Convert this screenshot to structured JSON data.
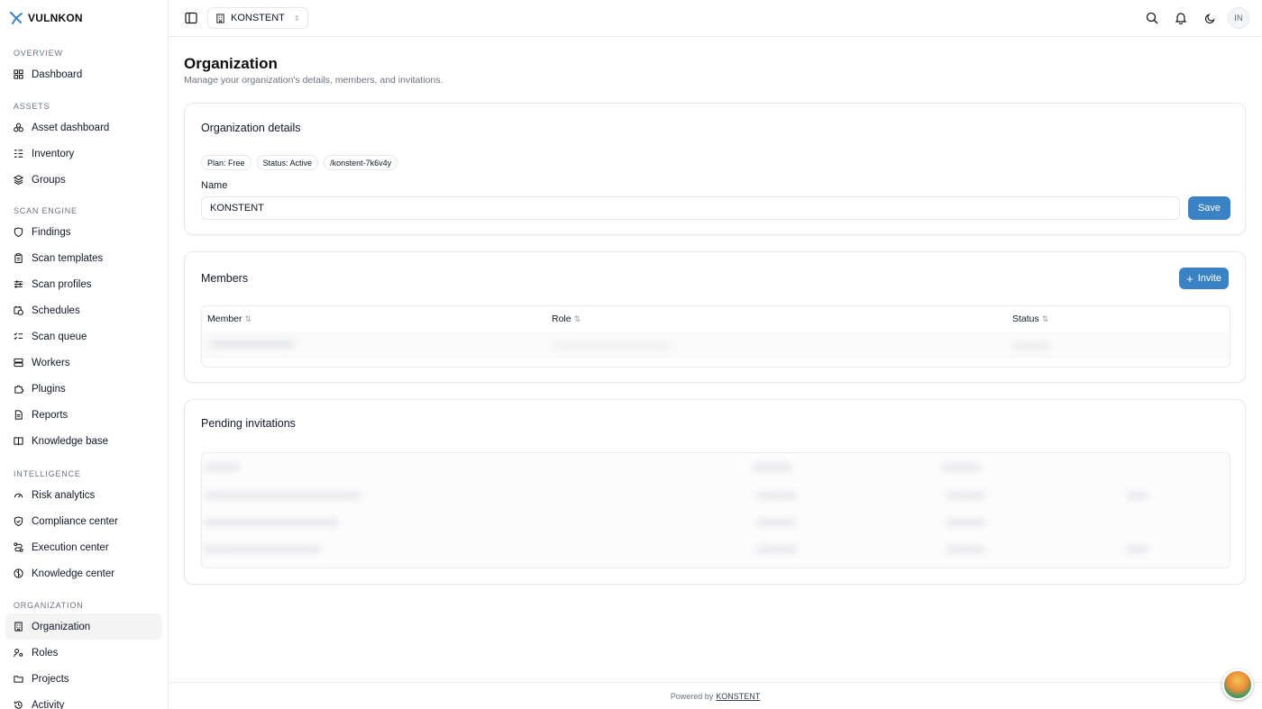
{
  "brand": {
    "name": "VULNKON"
  },
  "sidebar": {
    "sections": [
      {
        "title": "Overview",
        "items": [
          {
            "label": "Dashboard",
            "icon": "dashboard-icon"
          }
        ]
      },
      {
        "title": "Assets",
        "items": [
          {
            "label": "Asset dashboard",
            "icon": "asset-icon"
          },
          {
            "label": "Inventory",
            "icon": "inventory-icon"
          },
          {
            "label": "Groups",
            "icon": "layers-icon"
          }
        ]
      },
      {
        "title": "Scan engine",
        "items": [
          {
            "label": "Findings",
            "icon": "shield-icon"
          },
          {
            "label": "Scan templates",
            "icon": "clipboard-icon"
          },
          {
            "label": "Scan profiles",
            "icon": "sliders-icon"
          },
          {
            "label": "Schedules",
            "icon": "calendar-clock-icon"
          },
          {
            "label": "Scan queue",
            "icon": "list-checks-icon"
          },
          {
            "label": "Workers",
            "icon": "server-icon"
          },
          {
            "label": "Plugins",
            "icon": "puzzle-icon"
          },
          {
            "label": "Reports",
            "icon": "file-icon"
          },
          {
            "label": "Knowledge base",
            "icon": "book-icon"
          }
        ]
      },
      {
        "title": "Intelligence",
        "items": [
          {
            "label": "Risk analytics",
            "icon": "gauge-icon"
          },
          {
            "label": "Compliance center",
            "icon": "shield-check-icon"
          },
          {
            "label": "Execution center",
            "icon": "route-icon"
          },
          {
            "label": "Knowledge center",
            "icon": "brain-icon"
          }
        ]
      },
      {
        "title": "Organization",
        "items": [
          {
            "label": "Organization",
            "icon": "building-icon",
            "active": true
          },
          {
            "label": "Roles",
            "icon": "user-key-icon"
          },
          {
            "label": "Projects",
            "icon": "folder-icon"
          },
          {
            "label": "Activity",
            "icon": "history-icon"
          }
        ]
      }
    ]
  },
  "topbar": {
    "org_name": "KONSTENT",
    "avatar_initials": "IN"
  },
  "page": {
    "title": "Organization",
    "subtitle": "Manage your organization's details, members, and invitations."
  },
  "details": {
    "title": "Organization details",
    "badges": [
      "Plan: Free",
      "Status: Active",
      "/konstent-7k6v4y"
    ],
    "name_label": "Name",
    "name_value": "KONSTENT",
    "save_label": "Save"
  },
  "members": {
    "title": "Members",
    "invite_label": "Invite",
    "columns": [
      "Member",
      "Role",
      "Status"
    ]
  },
  "invitations": {
    "title": "Pending invitations"
  },
  "footer": {
    "prefix": "Powered by",
    "link": "KONSTENT"
  },
  "colors": {
    "accent": "#3b82c4",
    "brand_icon": "#3b82c4"
  }
}
